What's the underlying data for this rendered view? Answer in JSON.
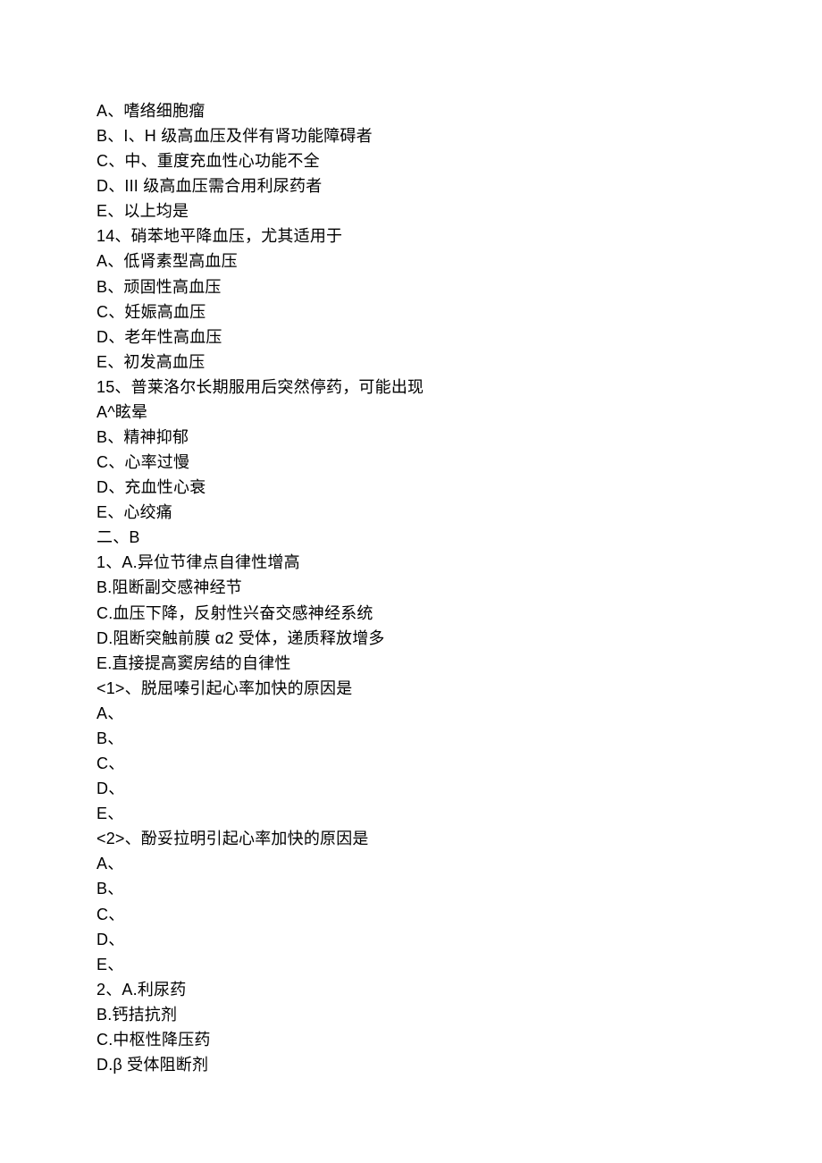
{
  "lines": {
    "l00": "A、嗜络细胞瘤",
    "l01": "B、I、H 级高血压及伴有肾功能障碍者",
    "l02": "C、中、重度充血性心功能不全",
    "l03": "D、III 级高血压需合用利尿药者",
    "l04": "E、以上均是",
    "l05": "14、硝苯地平降血压，尤其适用于",
    "l06": "A、低肾素型高血压",
    "l07": "B、顽固性高血压",
    "l08": "C、妊娠高血压",
    "l09": "D、老年性高血压",
    "l10": "E、初发高血压",
    "l11": "15、普莱洛尔长期服用后突然停药，可能出现",
    "l12": "A^眩晕",
    "l13": "B、精神抑郁",
    "l14": "C、心率过慢",
    "l15": "D、充血性心衰",
    "l16": "E、心绞痛",
    "l17": "二、B",
    "l18": "1、A.异位节律点自律性增高",
    "l19": "B.阻断副交感神经节",
    "l20": "C.血压下降，反射性兴奋交感神经系统",
    "l21": "D.阻断突触前膜 α2 受体，递质释放增多",
    "l22": "E.直接提高窦房结的自律性",
    "l23": "<1>、脱屈嗪引起心率加快的原因是",
    "l24": "A、",
    "l25": "B、",
    "l26": "C、",
    "l27": "D、",
    "l28": "E、",
    "l29": "<2>、酚妥拉明引起心率加快的原因是",
    "l30": "A、",
    "l31": "B、",
    "l32": "C、",
    "l33": "D、",
    "l34": "E、",
    "l35": "2、A.利尿药",
    "l36": "B.钙拮抗剂",
    "l37": "C.中枢性降压药",
    "l38": "D.β 受体阻断剂"
  }
}
